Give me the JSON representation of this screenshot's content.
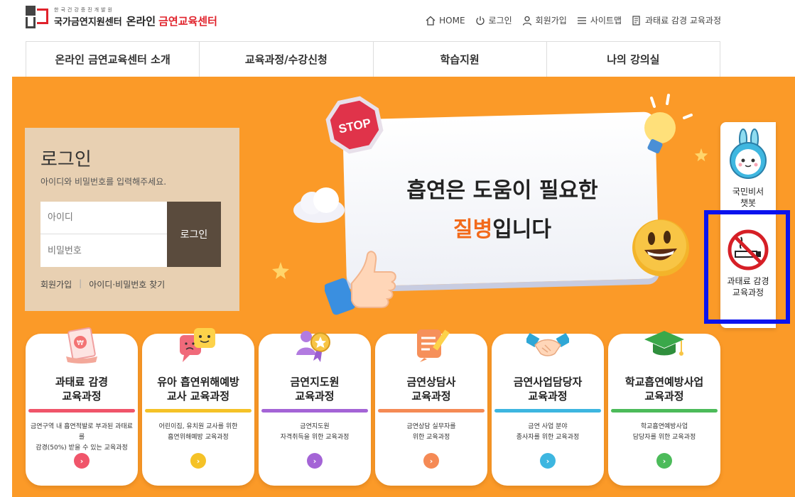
{
  "header": {
    "logo_small": "한국건강증진개발원",
    "logo_org": "국가금연지원센터",
    "logo_online": "온라인",
    "logo_center": "금연교육센터",
    "util": [
      {
        "label": "HOME",
        "icon": "home-icon"
      },
      {
        "label": "로그인",
        "icon": "power-icon"
      },
      {
        "label": "회원가입",
        "icon": "user-icon"
      },
      {
        "label": "사이트맵",
        "icon": "menu-icon"
      },
      {
        "label": "과태료 감경 교육과정",
        "icon": "document-icon"
      }
    ]
  },
  "nav": [
    {
      "label": "온라인 금연교육센터 소개"
    },
    {
      "label": "교육과정/수강신청"
    },
    {
      "label": "학습지원"
    },
    {
      "label": "나의 강의실"
    }
  ],
  "login": {
    "title": "로그인",
    "desc": "아이디와 비밀번호를 입력해주세요.",
    "id_placeholder": "아이디",
    "pw_placeholder": "비밀번호",
    "button": "로그인",
    "signup": "회원가입",
    "find": "아이디·비밀번호 찾기"
  },
  "banner": {
    "line1": "흡연은 도움이 필요한",
    "line2_highlight": "질병",
    "line2_rest": "입니다",
    "stop_text": "STOP"
  },
  "quick_menu": [
    {
      "label": "국민비서 챗봇",
      "line1": "국민비서",
      "line2": "챗봇",
      "icon": "chatbot-icon"
    },
    {
      "label": "과태료 감경 교육과정",
      "line1": "과태료 감경",
      "line2": "교육과정",
      "icon": "no-smoking-icon"
    }
  ],
  "courses": [
    {
      "title1": "과태료 감경",
      "title2": "교육과정",
      "desc1": "금연구역 내 흡연적발로 부과된 과태료를",
      "desc2": "감경(50%) 받을 수 있는 교육과정",
      "color": "#f0556a",
      "icon": "certificate-icon"
    },
    {
      "title1": "유아 흡연위해예방",
      "title2": "교사 교육과정",
      "desc1": "어린이집, 유치원 교사를 위한",
      "desc2": "흡연위해예방 교육과정",
      "color": "#f5c227",
      "icon": "speech-bubbles-icon"
    },
    {
      "title1": "금연지도원",
      "title2": "교육과정",
      "desc1": "금연지도원",
      "desc2": "자격취득을 위한 교육과정",
      "color": "#a464d6",
      "icon": "award-person-icon"
    },
    {
      "title1": "금연상담사",
      "title2": "교육과정",
      "desc1": "금연상담 실무자를",
      "desc2": "위한 교육과정",
      "color": "#f58a55",
      "icon": "note-pencil-icon"
    },
    {
      "title1": "금연사업담당자",
      "title2": "교육과정",
      "desc1": "금연 사업 분야",
      "desc2": "종사자를 위한 교육과정",
      "color": "#3db6e0",
      "icon": "handshake-icon"
    },
    {
      "title1": "학교흡연예방사업",
      "title2": "교육과정",
      "desc1": "학교흡연예방사업",
      "desc2": "담당자를 위한 교육과정",
      "color": "#4cbb5a",
      "icon": "graduation-cap-icon"
    }
  ]
}
